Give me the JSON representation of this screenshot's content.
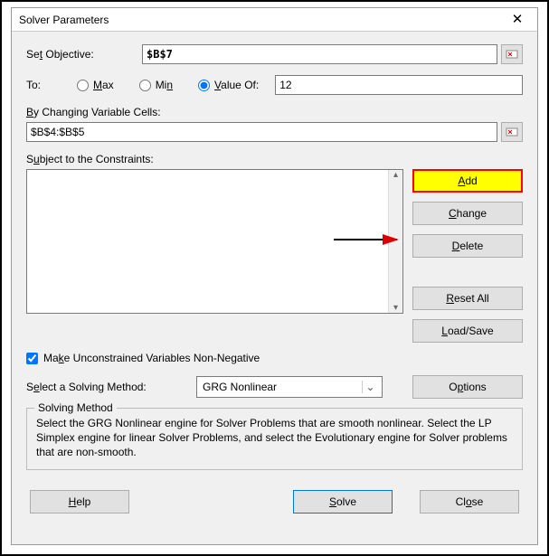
{
  "window": {
    "title": "Solver Parameters",
    "close_glyph": "✕"
  },
  "objective": {
    "label_pre": "Se",
    "label_u": "t",
    "label_post": " Objective:",
    "value": "$B$7"
  },
  "to": {
    "label": "To:",
    "max_u": "M",
    "max_post": "ax",
    "min_pre": "Mi",
    "min_u": "n",
    "valueof_u": "V",
    "valueof_post": "alue Of:",
    "value": "12"
  },
  "changing": {
    "label_u": "B",
    "label_post": "y Changing Variable Cells:",
    "value": "$B$4:$B$5"
  },
  "constraints": {
    "label_pre": "S",
    "label_u": "u",
    "label_post": "bject to the Constraints:"
  },
  "buttons": {
    "add_u": "A",
    "add_post": "dd",
    "change_u": "C",
    "change_post": "hange",
    "delete_u": "D",
    "delete_post": "elete",
    "reset_u": "R",
    "reset_post": "eset All",
    "load_u": "L",
    "load_post": "oad/Save",
    "options_pre": "O",
    "options_u": "p",
    "options_post": "tions",
    "help_u": "H",
    "help_post": "elp",
    "solve_u": "S",
    "solve_post": "olve",
    "close_pre": "Cl",
    "close_u": "o",
    "close_post": "se"
  },
  "nonneg": {
    "pre": "Ma",
    "u": "k",
    "post": "e Unconstrained Variables Non-Negative"
  },
  "method": {
    "label_pre": "S",
    "label_u": "e",
    "label_post": "lect a Solving Method:",
    "selected": "GRG Nonlinear"
  },
  "group": {
    "title": "Solving Method",
    "desc": "Select the GRG Nonlinear engine for Solver Problems that are smooth nonlinear. Select the LP Simplex engine for linear Solver Problems, and select the Evolutionary engine for Solver problems that are non-smooth."
  },
  "scroll": {
    "up": "▴",
    "down": "▾"
  }
}
